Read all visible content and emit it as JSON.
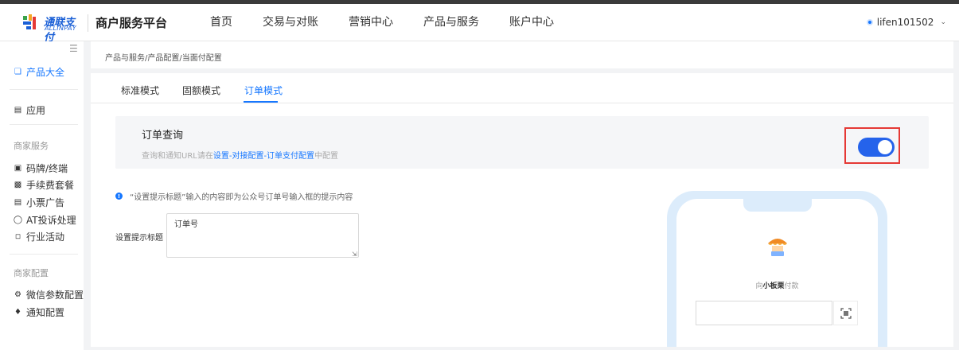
{
  "brand": {
    "logo_cn": "通联支付",
    "logo_en": "ALLINPAY",
    "platform_title": "商户服务平台",
    "colors": {
      "primary": "#1677ff",
      "toggle": "#2563eb",
      "highlight": "#e53935"
    }
  },
  "nav": {
    "items": [
      {
        "label": "首页"
      },
      {
        "label": "交易与对账"
      },
      {
        "label": "营销中心"
      },
      {
        "label": "产品与服务"
      },
      {
        "label": "账户中心"
      }
    ]
  },
  "user": {
    "name": "lifen101502",
    "dropdown_icon": "chevron-down-icon"
  },
  "sidebar": {
    "top_item": {
      "label": "产品大全",
      "icon": "cube-icon"
    },
    "app_item": {
      "label": "应用",
      "icon": "app-box-icon"
    },
    "group1_label": "商家服务",
    "group1_items": [
      {
        "label": "码牌/终端",
        "icon": "terminal-icon"
      },
      {
        "label": "手续费套餐",
        "icon": "fee-icon"
      },
      {
        "label": "小票广告",
        "icon": "receipt-icon"
      },
      {
        "label": "AT投诉处理",
        "icon": "complaint-icon"
      },
      {
        "label": "行业活动",
        "icon": "cart-icon"
      }
    ],
    "group2_label": "商家配置",
    "group2_items": [
      {
        "label": "微信参数配置",
        "icon": "wechat-settings-icon"
      },
      {
        "label": "通知配置",
        "icon": "bell-icon"
      }
    ]
  },
  "breadcrumb": "产品与服务/产品配置/当面付配置",
  "tabs": [
    {
      "label": "标准模式"
    },
    {
      "label": "固额模式"
    },
    {
      "label": "订单模式"
    }
  ],
  "active_tab": "订单模式",
  "order_query": {
    "title": "订单查询",
    "desc_prefix": "查询和通知URL请在",
    "desc_link": "设置-对接配置-订单支付配置",
    "desc_suffix": "中配置",
    "enabled": true
  },
  "notice": "“设置提示标题”输入的内容即为公众号订单号输入框的提示内容",
  "form": {
    "label": "设置提示标题",
    "value": "订单号"
  },
  "preview": {
    "pay_prefix": "向",
    "merchant": "小板栗",
    "pay_suffix": "付款",
    "scan_icon": "scan-icon"
  }
}
